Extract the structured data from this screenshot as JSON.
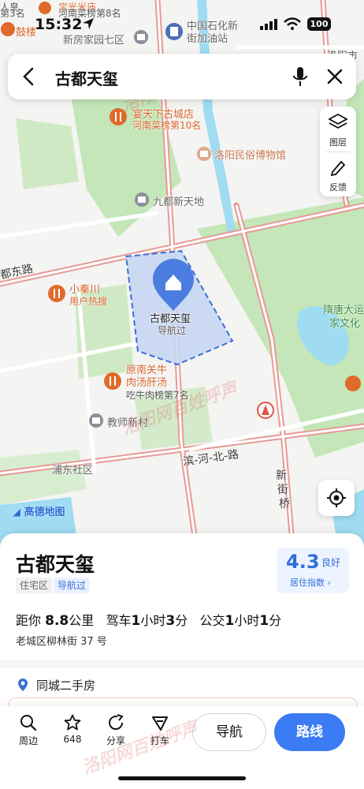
{
  "status_bar": {
    "time": "15:32",
    "battery": "100"
  },
  "search": {
    "query": "古都天玺"
  },
  "side_tools": {
    "layers_label": "图层",
    "feedback_label": "反馈"
  },
  "map": {
    "labels": {
      "top_poi_1": "人皇",
      "top_poi_1_sub": "第3名",
      "top_poi_2": "宝光米庙",
      "top_poi_2_sub": "河南菜榜第8名",
      "top_poi_3": "鼓楼",
      "xinfang": "新房家园七区",
      "sinopec": "中国石化新",
      "sinopec_2": "街加油站",
      "luoyang_right": "洛阳市",
      "yantianxia": "宴天下古城店",
      "yantianxia_sub": "河南菜榜第10名",
      "museum": "洛阳民俗博物馆",
      "jiudu": "九都新天地",
      "dudong_road": "都东路",
      "xiaoqinchuan": "小秦川",
      "xiaoqinchuan_sub": "用户热搜",
      "target_name": "古都天玺",
      "target_sub": "导航过",
      "suitang": "隋唐大运",
      "suitang_2": "家文化",
      "yuannan": "原南关牛",
      "yuannan_2": "肉汤肝汤",
      "yuannan_sub": "吃牛肉榜第7名",
      "jiaoshi": "教师新村",
      "pudong": "浦东社区",
      "binhe": "滨-河-北-路",
      "xinjie_1": "新",
      "xinjie_2": "街",
      "xinjie_3": "桥",
      "logo": "高德地图"
    },
    "watermarks": [
      "洛阳网百姓呼声",
      "洛阳网百姓呼声",
      "洛阳网百姓呼声",
      "洛阳网百姓呼声"
    ]
  },
  "card": {
    "name": "古都天玺",
    "tag_type": "住宅区",
    "tag_nav": "导航过",
    "score": "4.3",
    "score_grade": "良好",
    "score_label": "居住指数 ›",
    "distance_prefix": "距你",
    "distance_value": "8.8",
    "distance_unit": "公里",
    "drive_prefix": "驾车",
    "drive_hours": "1",
    "drive_hours_unit": "小时",
    "drive_minutes": "3",
    "drive_minutes_unit": "分",
    "bus_prefix": "公交",
    "bus_hours": "1",
    "bus_hours_unit": "小时",
    "bus_minutes": "1",
    "bus_minutes_unit": "分",
    "address": "老城区柳林街 37 号",
    "house_section": "同城二手房"
  },
  "tabbar": {
    "nearby": "周边",
    "favorite_count": "648",
    "share": "分享",
    "taxi": "打车",
    "navigate": "导航",
    "route": "路线"
  },
  "colors": {
    "accent": "#3b7cf5",
    "green_area": "#bfe5b5",
    "road_red": "#e08a86",
    "water": "#8fd6f0",
    "poi_orange": "#e06a2b"
  }
}
